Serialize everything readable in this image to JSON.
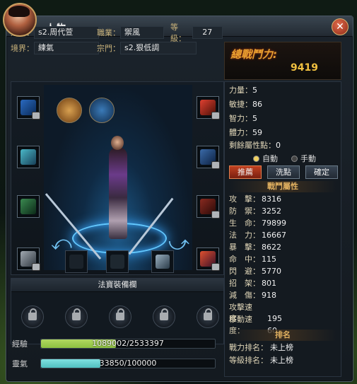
{
  "window": {
    "title": "人物",
    "close_label": "✕"
  },
  "info": {
    "name_label": "姓名：",
    "name_value": "s2.周代萱",
    "job_label": "職業：",
    "job_value": "禦風",
    "level_label": "等級：",
    "level_value": "27",
    "realm_label": "境界：",
    "realm_value": "練氣",
    "sect_label": "宗門：",
    "sect_value": "s2.狠低調"
  },
  "power": {
    "label": "總戰鬥力:",
    "value": "9419"
  },
  "attributes": [
    {
      "label": "力量：",
      "value": "5"
    },
    {
      "label": "敏捷：",
      "value": "86"
    },
    {
      "label": "智力：",
      "value": "5"
    },
    {
      "label": "體力：",
      "value": "59"
    },
    {
      "label": "剩餘屬性點：",
      "value": "0"
    }
  ],
  "mode": {
    "auto": "自動",
    "manual": "手動",
    "selected": "auto"
  },
  "buttons": {
    "recommend": "推薦",
    "reset": "洗點",
    "confirm": "確定"
  },
  "combat_title": "戰鬥屬性",
  "combat": [
    {
      "label": "攻　擊：",
      "value": "8316"
    },
    {
      "label": "防　禦：",
      "value": "3252"
    },
    {
      "label": "生　命：",
      "value": "79899"
    },
    {
      "label": "法　力：",
      "value": "16667"
    },
    {
      "label": "暴　擊：",
      "value": "8622"
    },
    {
      "label": "命　中：",
      "value": "115"
    },
    {
      "label": "閃　避：",
      "value": "5770"
    },
    {
      "label": "招　架：",
      "value": "801"
    },
    {
      "label": "減　傷：",
      "value": "918"
    },
    {
      "label": "攻擊速度：",
      "value": "195"
    },
    {
      "label": "移動速度：",
      "value": "60"
    }
  ],
  "rank_title": "排名",
  "ranks": [
    {
      "label": "戰力排名：",
      "value": "未上榜"
    },
    {
      "label": "等級排名：",
      "value": "未上榜"
    }
  ],
  "treasure_title": "法寶裝備欄",
  "bars": {
    "exp": {
      "label": "經驗",
      "text": "1089002/2533397",
      "fraction": 0.43,
      "color": "#8cc040"
    },
    "aura": {
      "label": "靈氣",
      "text": "33850/100000",
      "fraction": 0.34,
      "color": "#50c0c0"
    }
  },
  "colors": {
    "accent": "#e8a030",
    "power_value": "#f0c040",
    "label_gold": "#c9b27a"
  }
}
